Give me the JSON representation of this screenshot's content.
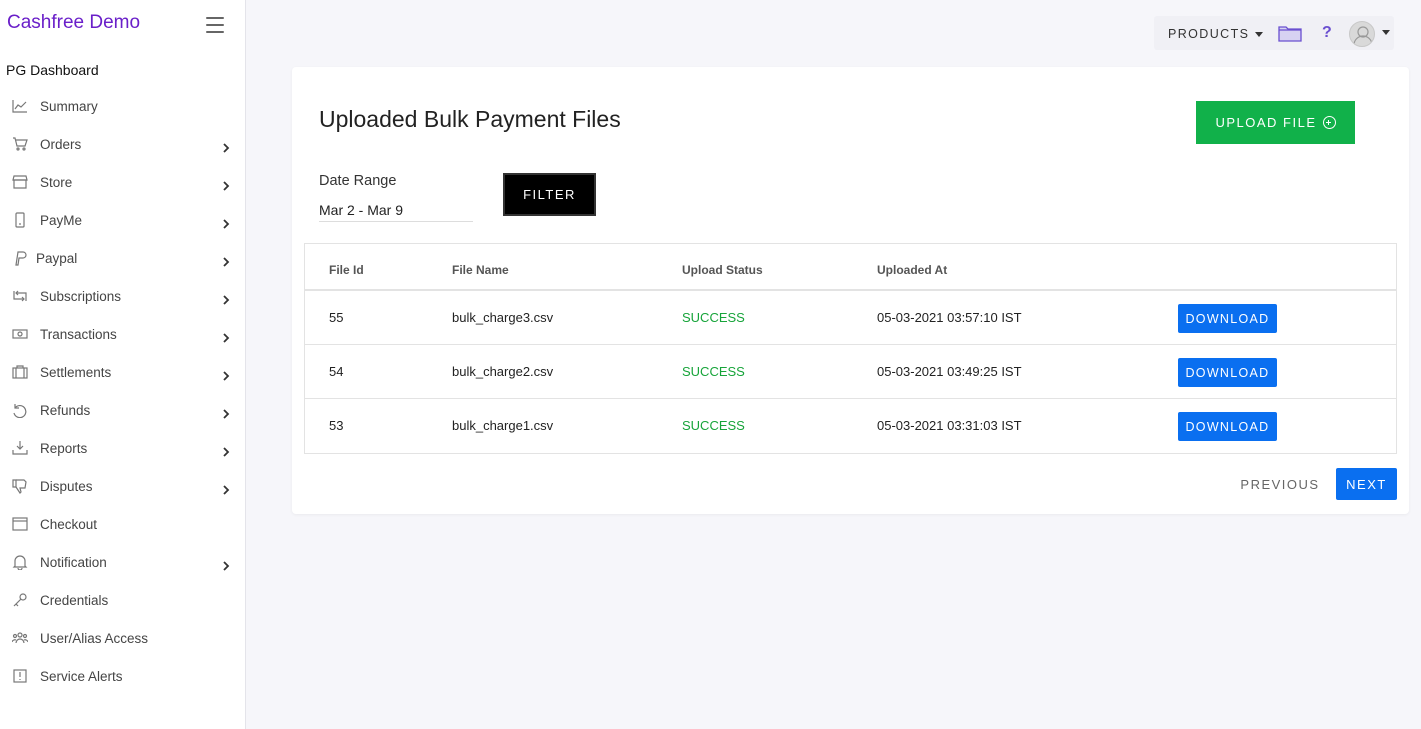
{
  "sidebar": {
    "brand": "Cashfree Demo",
    "section_title": "PG Dashboard",
    "items": [
      {
        "label": "Summary",
        "icon": "chart-line-icon",
        "has_children": false
      },
      {
        "label": "Orders",
        "icon": "cart-icon",
        "has_children": true
      },
      {
        "label": "Store",
        "icon": "store-icon",
        "has_children": true
      },
      {
        "label": "PayMe",
        "icon": "phone-icon",
        "has_children": true
      },
      {
        "label": "Paypal",
        "icon": "paypal-icon",
        "has_children": true
      },
      {
        "label": "Subscriptions",
        "icon": "repeat-icon",
        "has_children": true
      },
      {
        "label": "Transactions",
        "icon": "cash-icon",
        "has_children": true
      },
      {
        "label": "Settlements",
        "icon": "briefcase-icon",
        "has_children": true
      },
      {
        "label": "Refunds",
        "icon": "refund-icon",
        "has_children": true
      },
      {
        "label": "Reports",
        "icon": "download-icon",
        "has_children": true
      },
      {
        "label": "Disputes",
        "icon": "thumbs-down-icon",
        "has_children": true
      },
      {
        "label": "Checkout",
        "icon": "window-icon",
        "has_children": false
      },
      {
        "label": "Notification",
        "icon": "bell-icon",
        "has_children": true
      },
      {
        "label": "Credentials",
        "icon": "key-icon",
        "has_children": false
      },
      {
        "label": "User/Alias Access",
        "icon": "users-icon",
        "has_children": false
      },
      {
        "label": "Service Alerts",
        "icon": "alert-icon",
        "has_children": false
      }
    ]
  },
  "topbar": {
    "products_label": "PRODUCTS",
    "help_label": "?"
  },
  "main": {
    "title": "Uploaded Bulk Payment Files",
    "upload_label": "UPLOAD FILE",
    "date_range_label": "Date Range",
    "date_range_value": "Mar 2 - Mar 9",
    "filter_label": "FILTER",
    "table": {
      "headers": [
        "File Id",
        "File Name",
        "Upload Status",
        "Uploaded At"
      ],
      "rows": [
        {
          "id": "55",
          "name": "bulk_charge3.csv",
          "status": "SUCCESS",
          "uploaded_at": "05-03-2021 03:57:10 IST",
          "action": "DOWNLOAD"
        },
        {
          "id": "54",
          "name": "bulk_charge2.csv",
          "status": "SUCCESS",
          "uploaded_at": "05-03-2021 03:49:25 IST",
          "action": "DOWNLOAD"
        },
        {
          "id": "53",
          "name": "bulk_charge1.csv",
          "status": "SUCCESS",
          "uploaded_at": "05-03-2021 03:31:03 IST",
          "action": "DOWNLOAD"
        }
      ]
    },
    "pagination": {
      "previous_label": "PREVIOUS",
      "next_label": "NEXT"
    }
  },
  "colors": {
    "brand": "#6a1fc9",
    "upload_button": "#11b14a",
    "primary_button": "#0a6ff0",
    "success_text": "#17a43a",
    "background": "#f6f6fa"
  }
}
